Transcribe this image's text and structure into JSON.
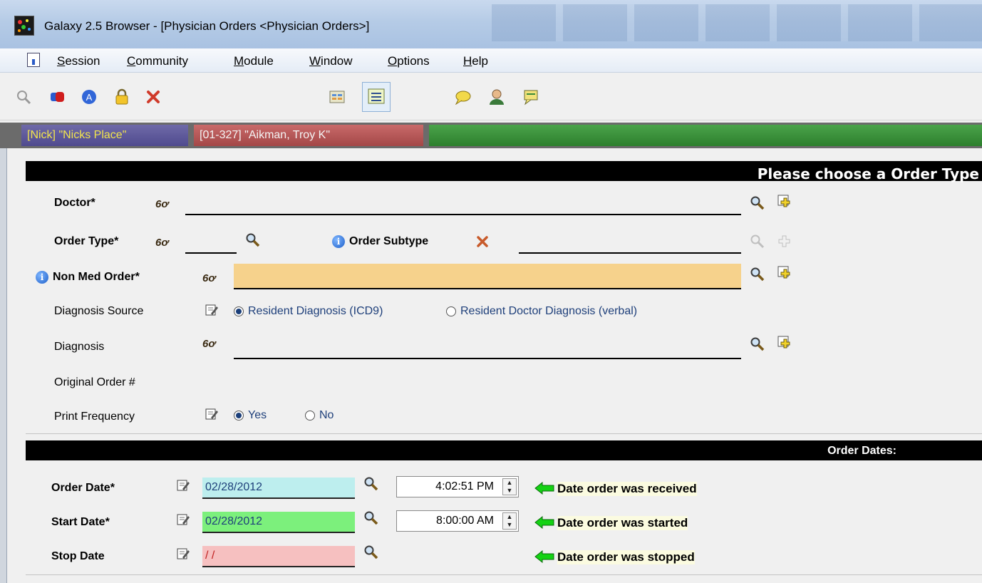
{
  "window": {
    "title": "Galaxy 2.5 Browser - [Physician Orders  <Physician Orders>]"
  },
  "menu": [
    {
      "label": "Session"
    },
    {
      "label": "Community"
    },
    {
      "label": "Module"
    },
    {
      "label": "Window"
    },
    {
      "label": "Options"
    },
    {
      "label": "Help"
    }
  ],
  "context": {
    "facility": "[Nick] \"Nicks Place\"",
    "resident": "[01-327] \"Aikman, Troy K\""
  },
  "header": {
    "title": "Please choose a Order Type"
  },
  "form": {
    "doctor_label": "Doctor*",
    "order_type_label": "Order Type*",
    "order_subtype_label": "Order Subtype",
    "non_med_order_label": "Non Med Order*",
    "diagnosis_source_label": "Diagnosis Source",
    "diag_opt1": "Resident Diagnosis (ICD9)",
    "diag_opt2": "Resident Doctor Diagnosis (verbal)",
    "diagnosis_label": "Diagnosis",
    "original_order_label": "Original Order #",
    "print_frequency_label": "Print Frequency",
    "yes": "Yes",
    "no": "No",
    "glasses_glyph": "6ơ"
  },
  "dates_header": "Order Dates:",
  "dates": {
    "order_date_label": "Order Date*",
    "order_date": "02/28/2012",
    "order_time": "4:02:51 PM",
    "order_hint": "Date order was received",
    "start_date_label": "Start Date*",
    "start_date": "02/28/2012",
    "start_time": "8:00:00 AM",
    "start_hint": "Date order was started",
    "stop_date_label": "Stop Date",
    "stop_date": " / /",
    "stop_hint": "Date order was stopped"
  },
  "colors": {
    "order_date_bg": "#bdeeee",
    "start_date_bg": "#7cf07c",
    "stop_date_bg": "#f6c0c0",
    "non_med_bg": "#f6d28c",
    "arrow": "#14d214"
  }
}
